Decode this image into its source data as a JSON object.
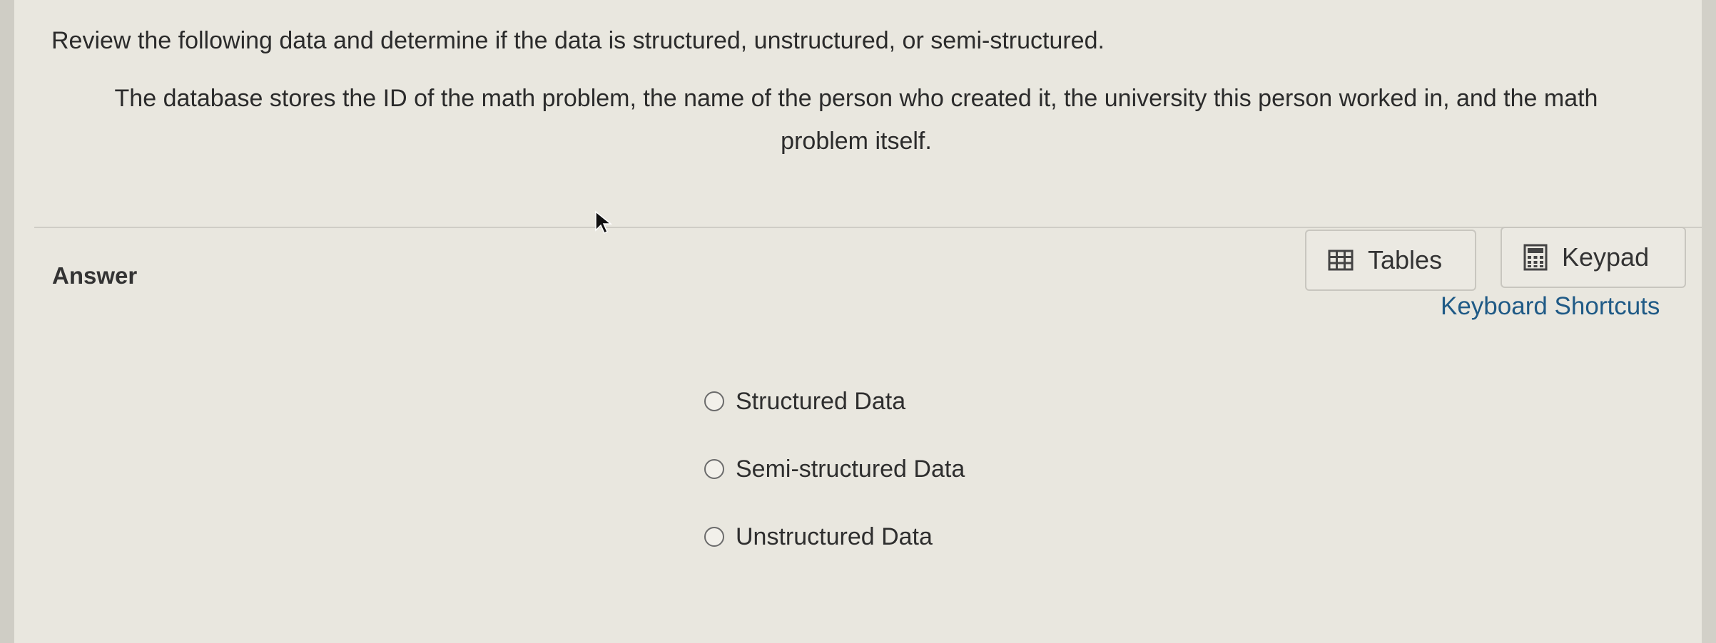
{
  "question": {
    "instruction": "Review the following data and determine if the data is structured, unstructured, or semi-structured.",
    "body": "The database stores the ID of the math problem, the name of the person who created it, the university this person worked in, and the math problem itself."
  },
  "answer": {
    "label": "Answer",
    "tools": {
      "tables_label": "Tables",
      "tables_icon": "table-icon",
      "keypad_label": "Keypad",
      "keypad_icon": "calculator-icon",
      "shortcuts_label": "Keyboard Shortcuts"
    },
    "options": [
      {
        "label": "Structured Data",
        "selected": false
      },
      {
        "label": "Semi-structured Data",
        "selected": false
      },
      {
        "label": "Unstructured Data",
        "selected": false
      }
    ]
  },
  "colors": {
    "background": "#e9e7df",
    "link": "#1f5a86",
    "text": "#2b2b2b"
  }
}
